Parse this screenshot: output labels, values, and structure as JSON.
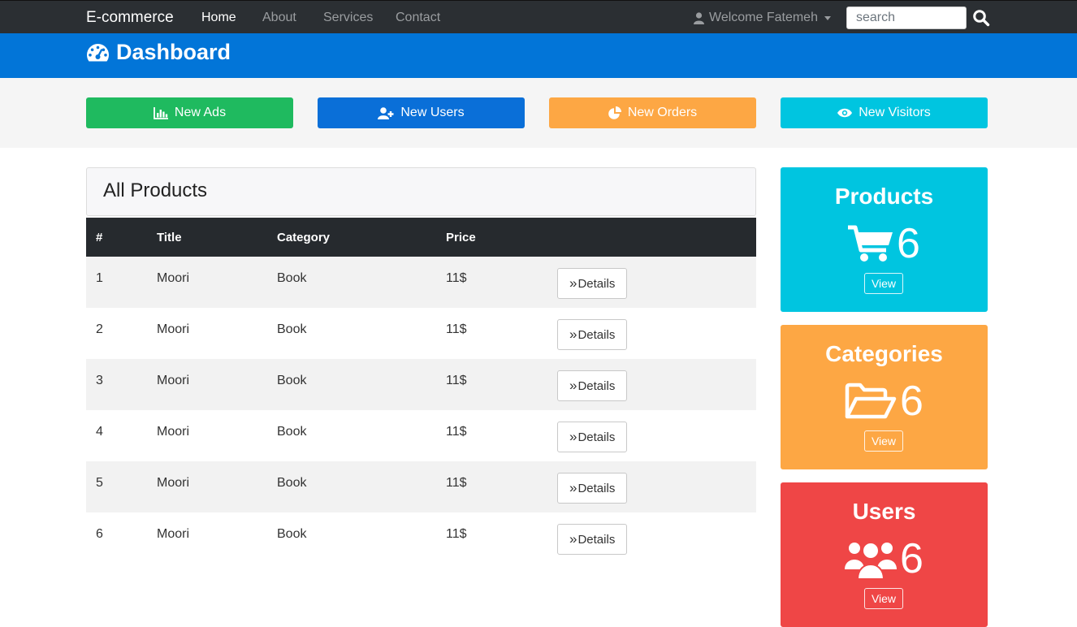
{
  "navbar": {
    "brand": "E-commerce",
    "links": [
      "Home",
      "About",
      "Services",
      "Contact"
    ],
    "active": "Home",
    "welcome": "Welcome Fatemeh",
    "search_placeholder": "search"
  },
  "header": {
    "title": "Dashboard"
  },
  "actions": [
    {
      "label": "New Ads",
      "icon": "bar-chart-icon",
      "color": "#1fba5f"
    },
    {
      "label": "New Users",
      "icon": "user-plus-icon",
      "color": "#0a6fd8"
    },
    {
      "label": "New Orders",
      "icon": "pie-chart-icon",
      "color": "#fda744"
    },
    {
      "label": "New Visitors",
      "icon": "eye-icon",
      "color": "#00c5e0"
    }
  ],
  "products": {
    "heading": "All Products",
    "columns": [
      "#",
      "Title",
      "Category",
      "Price"
    ],
    "rows": [
      {
        "num": "1",
        "title": "Moori",
        "category": "Book",
        "price": "11$",
        "button": "Details"
      },
      {
        "num": "2",
        "title": "Moori",
        "category": "Book",
        "price": "11$",
        "button": "Details"
      },
      {
        "num": "3",
        "title": "Moori",
        "category": "Book",
        "price": "11$",
        "button": "Details"
      },
      {
        "num": "4",
        "title": "Moori",
        "category": "Book",
        "price": "11$",
        "button": "Details"
      },
      {
        "num": "5",
        "title": "Moori",
        "category": "Book",
        "price": "11$",
        "button": "Details"
      },
      {
        "num": "6",
        "title": "Moori",
        "category": "Book",
        "price": "11$",
        "button": "Details"
      }
    ]
  },
  "stats": [
    {
      "title": "Products",
      "count": "6",
      "icon": "shopping-cart-icon",
      "view": "View",
      "color": "#00c5e0"
    },
    {
      "title": "Categories",
      "count": "6",
      "icon": "folder-open-icon",
      "view": "View",
      "color": "#fda744"
    },
    {
      "title": "Users",
      "count": "6",
      "icon": "users-icon",
      "view": "View",
      "color": "#ef4646"
    }
  ]
}
